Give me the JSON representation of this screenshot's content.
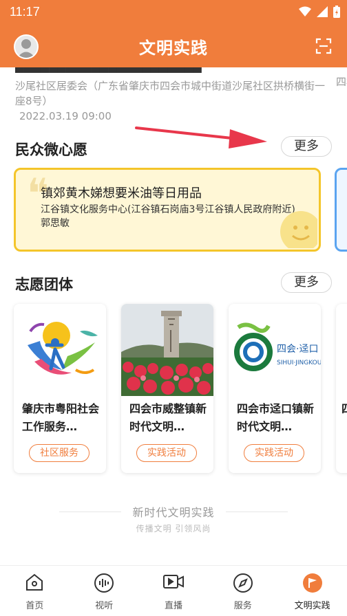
{
  "status": {
    "time": "11:17"
  },
  "header": {
    "title": "文明实践"
  },
  "prev_card": {
    "address": "沙尾社区居委会（广东省肇庆市四会市城中街道沙尾社区拱桥横街一座8号）",
    "date": "2022.03.19 09:00",
    "next_preview": "四村"
  },
  "wish_section": {
    "title": "民众微心愿",
    "more_label": "更多",
    "card": {
      "title": "镇郊黄木娣想要米油等日用品",
      "subtitle": "江谷镇文化服务中心(江谷镇石岗庙3号江谷镇人民政府附近) 郭思敏"
    }
  },
  "team_section": {
    "title": "志愿团体",
    "more_label": "更多",
    "teams": [
      {
        "name": "肇庆市粤阳社会工作服务…",
        "tag": "社区服务"
      },
      {
        "name": "四会市威整镇新时代文明…",
        "tag": "实践活动"
      },
      {
        "name": "四会市迳口镇新时代文明…",
        "tag": "实践活动"
      },
      {
        "name": "四",
        "tag": ""
      }
    ]
  },
  "logo_texts": {
    "jingkou_cn": "四会·迳口",
    "jingkou_en": "SIHUI·JINGKOU"
  },
  "footer": {
    "slogan": "新时代文明实践",
    "sub": "传播文明 引领风尚"
  },
  "tabbar": {
    "items": [
      {
        "label": "首页",
        "icon": "home-icon"
      },
      {
        "label": "视听",
        "icon": "audio-wave-icon"
      },
      {
        "label": "直播",
        "icon": "live-video-icon"
      },
      {
        "label": "服务",
        "icon": "compass-icon"
      },
      {
        "label": "文明实践",
        "icon": "flag-icon",
        "active": true
      }
    ]
  },
  "colors": {
    "brand": "#f07d3c",
    "wish_border": "#f4c52a",
    "wish_bg": "#fff7d6",
    "arrow": "#e8374b"
  }
}
